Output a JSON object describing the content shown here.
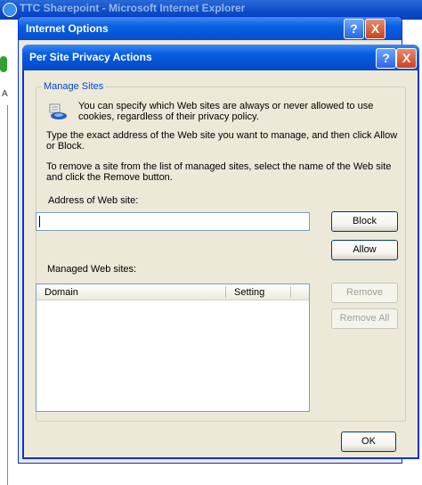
{
  "background": {
    "window_title": "TTC Sharepoint - Microsoft Internet Explorer",
    "side_letter": "A"
  },
  "internet_options": {
    "title": "Internet Options",
    "help_glyph": "?",
    "close_glyph": "X"
  },
  "dialog": {
    "title": "Per Site Privacy Actions",
    "help_glyph": "?",
    "close_glyph": "X",
    "group_label": "Manage Sites",
    "intro_line1": "You can specify which Web sites are always or never allowed to use",
    "intro_line2": "cookies, regardless of their privacy policy.",
    "instruction_line1": "Type the exact address of the Web site you want to manage, and then click Allow",
    "instruction_line2": "or Block.",
    "remove_line1": "To remove a site from the list of managed sites, select the name of the Web site",
    "remove_line2": "and click the Remove button.",
    "address_label": "Address of Web site:",
    "address_value": "",
    "block_label": "Block",
    "allow_label": "Allow",
    "managed_label": "Managed Web sites:",
    "columns": [
      "Domain",
      "Setting"
    ],
    "remove_label": "Remove",
    "remove_all_label": "Remove All",
    "ok_label": "OK"
  }
}
